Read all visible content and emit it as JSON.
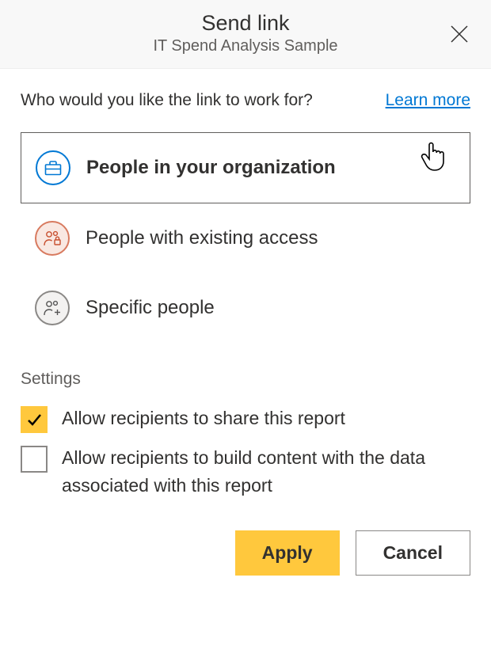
{
  "header": {
    "title": "Send link",
    "subtitle": "IT Spend Analysis Sample"
  },
  "prompt": "Who would you like the link to work for?",
  "learn_more": "Learn more",
  "options": {
    "org": "People in your organization",
    "existing": "People with existing access",
    "specific": "Specific people"
  },
  "settings": {
    "heading": "Settings",
    "allow_share": "Allow recipients to share this report",
    "allow_build": "Allow recipients to build content with the data associated with this report"
  },
  "buttons": {
    "apply": "Apply",
    "cancel": "Cancel"
  }
}
